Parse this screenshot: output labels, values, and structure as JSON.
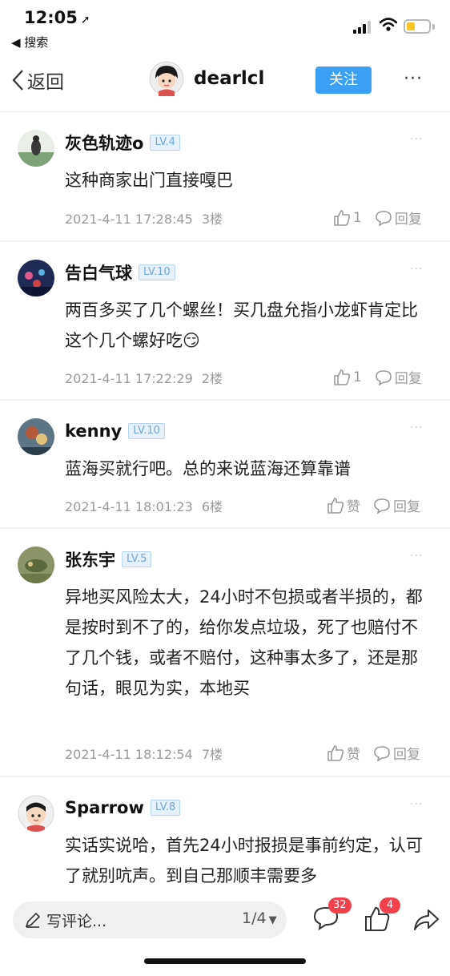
{
  "status_bar": {
    "time": "12:05",
    "back_app": "◀ 搜索"
  },
  "header": {
    "back_label": "返回",
    "username": "dearlcl",
    "follow_label": "关注",
    "more_label": "···"
  },
  "comments": [
    {
      "username": "灰色轨迹o",
      "level": "LV.4",
      "text": "这种商家出门直接嘎巴",
      "date": "2021-4-11 17:28:45",
      "floor": "3楼",
      "likes": "1",
      "reply_label": "回复",
      "avatar_color": "#9bb79a"
    },
    {
      "username": "告白气球",
      "level": "LV.10",
      "text": "两百多买了几个螺丝！买几盘允指小龙虾肯定比这个几个螺好吃😏",
      "date": "2021-4-11 17:22:29",
      "floor": "2楼",
      "likes": "1",
      "reply_label": "回复",
      "avatar_color": "#24325e"
    },
    {
      "username": "kenny",
      "level": "LV.10",
      "text": "蓝海买就行吧。总的来说蓝海还算靠谱",
      "date": "2021-4-11 18:01:23",
      "floor": "6楼",
      "likes": "赞",
      "reply_label": "回复",
      "avatar_color": "#6a7f8f"
    },
    {
      "username": "张东宇",
      "level": "LV.5",
      "text": "异地买风险太大，24小时不包损或者半损的，都是按时到不了的，给你发点垃圾，死了也赔付不了几个钱，或者不赔付，这种事太多了，还是那句话，眼见为实，本地买",
      "date": "2021-4-11 18:12:54",
      "floor": "7楼",
      "likes": "赞",
      "reply_label": "回复",
      "avatar_color": "#7e8a5a"
    },
    {
      "username": "Sparrow",
      "level": "LV.8",
      "text": "实话实说哈，首先24小时报损是事前约定，认可了就别吭声。到自己那顺丰需要多",
      "date": "",
      "floor": "",
      "likes": "",
      "reply_label": "",
      "avatar_color": "#f0f0f0"
    }
  ],
  "bottom_bar": {
    "input_placeholder": "写评论...",
    "page_indicator": "1/4",
    "comment_count": "32",
    "like_count": "4"
  },
  "colors": {
    "accent": "#3aa0f5",
    "badge": "#f2414a",
    "meta_text": "#9a9a9a"
  }
}
